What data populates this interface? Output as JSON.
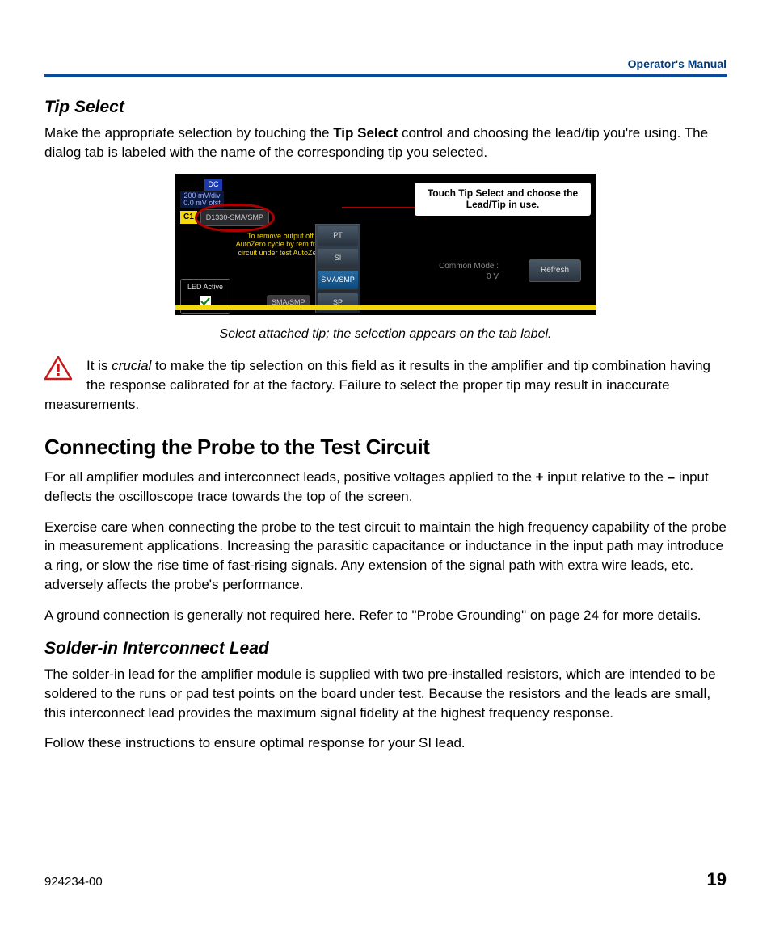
{
  "header": {
    "right": "Operator's Manual"
  },
  "tipSelect": {
    "heading": "Tip Select",
    "para_a": "Make the appropriate selection by touching the ",
    "para_bold": "Tip Select",
    "para_b": " control and choosing the lead/tip you're using. The dialog tab is labeled with the name of the corresponding tip you selected."
  },
  "figure": {
    "dc": "DC",
    "scale1": "200 mV/div",
    "scale2": "0.0 mV ofst",
    "c1": "C1",
    "tipBtn": "D1330-SMA/SMP",
    "callout": "Touch Tip Select and choose the Lead/Tip in use.",
    "hint": "To remove output off AutoZero cycle by rem from circuit under test AutoZero",
    "options": [
      "PT",
      "SI",
      "SMA/SMP",
      "SP"
    ],
    "ledLabel": "LED Active",
    "tabLabel": "SMA/SMP",
    "commonModeLabel": "Common Mode :",
    "commonModeValue": "0 V",
    "refresh": "Refresh"
  },
  "caption": "Select attached tip; the selection appears on the tab label.",
  "warning": {
    "a": "It is ",
    "crucial": "crucial",
    "b": " to make the tip selection on this field as it results in the amplifier and tip combination having the response calibrated for at the factory. Failure to select the proper tip may result in inaccurate measurements."
  },
  "connecting": {
    "heading": "Connecting the Probe to the Test Circuit",
    "p1a": "For all amplifier modules and interconnect leads, positive voltages applied to the ",
    "p1plus": "+",
    "p1b": " input relative to the ",
    "p1minus": "–",
    "p1c": " input deflects the oscilloscope trace towards the top of the screen.",
    "p2": "Exercise care when connecting the probe to the test circuit to maintain the high frequency capability of the probe in measurement applications. Increasing the parasitic capacitance or inductance in the input path may introduce a ring, or slow the rise time of fast-rising signals. Any extension of the signal path with extra wire leads, etc. adversely affects the probe's performance.",
    "p3": "A ground connection is generally not required here. Refer to \"Probe Grounding\" on page 24 for more details."
  },
  "solder": {
    "heading": "Solder-in Interconnect Lead",
    "p1": "The solder-in lead for the amplifier module is supplied with two pre-installed resistors, which are intended to be soldered to the runs or pad test points on the board under test. Because the resistors and the leads are small, this interconnect lead provides the maximum signal fidelity at the highest frequency response.",
    "p2": "Follow these instructions to ensure optimal response for your SI lead."
  },
  "footer": {
    "docnum": "924234-00",
    "page": "19"
  }
}
